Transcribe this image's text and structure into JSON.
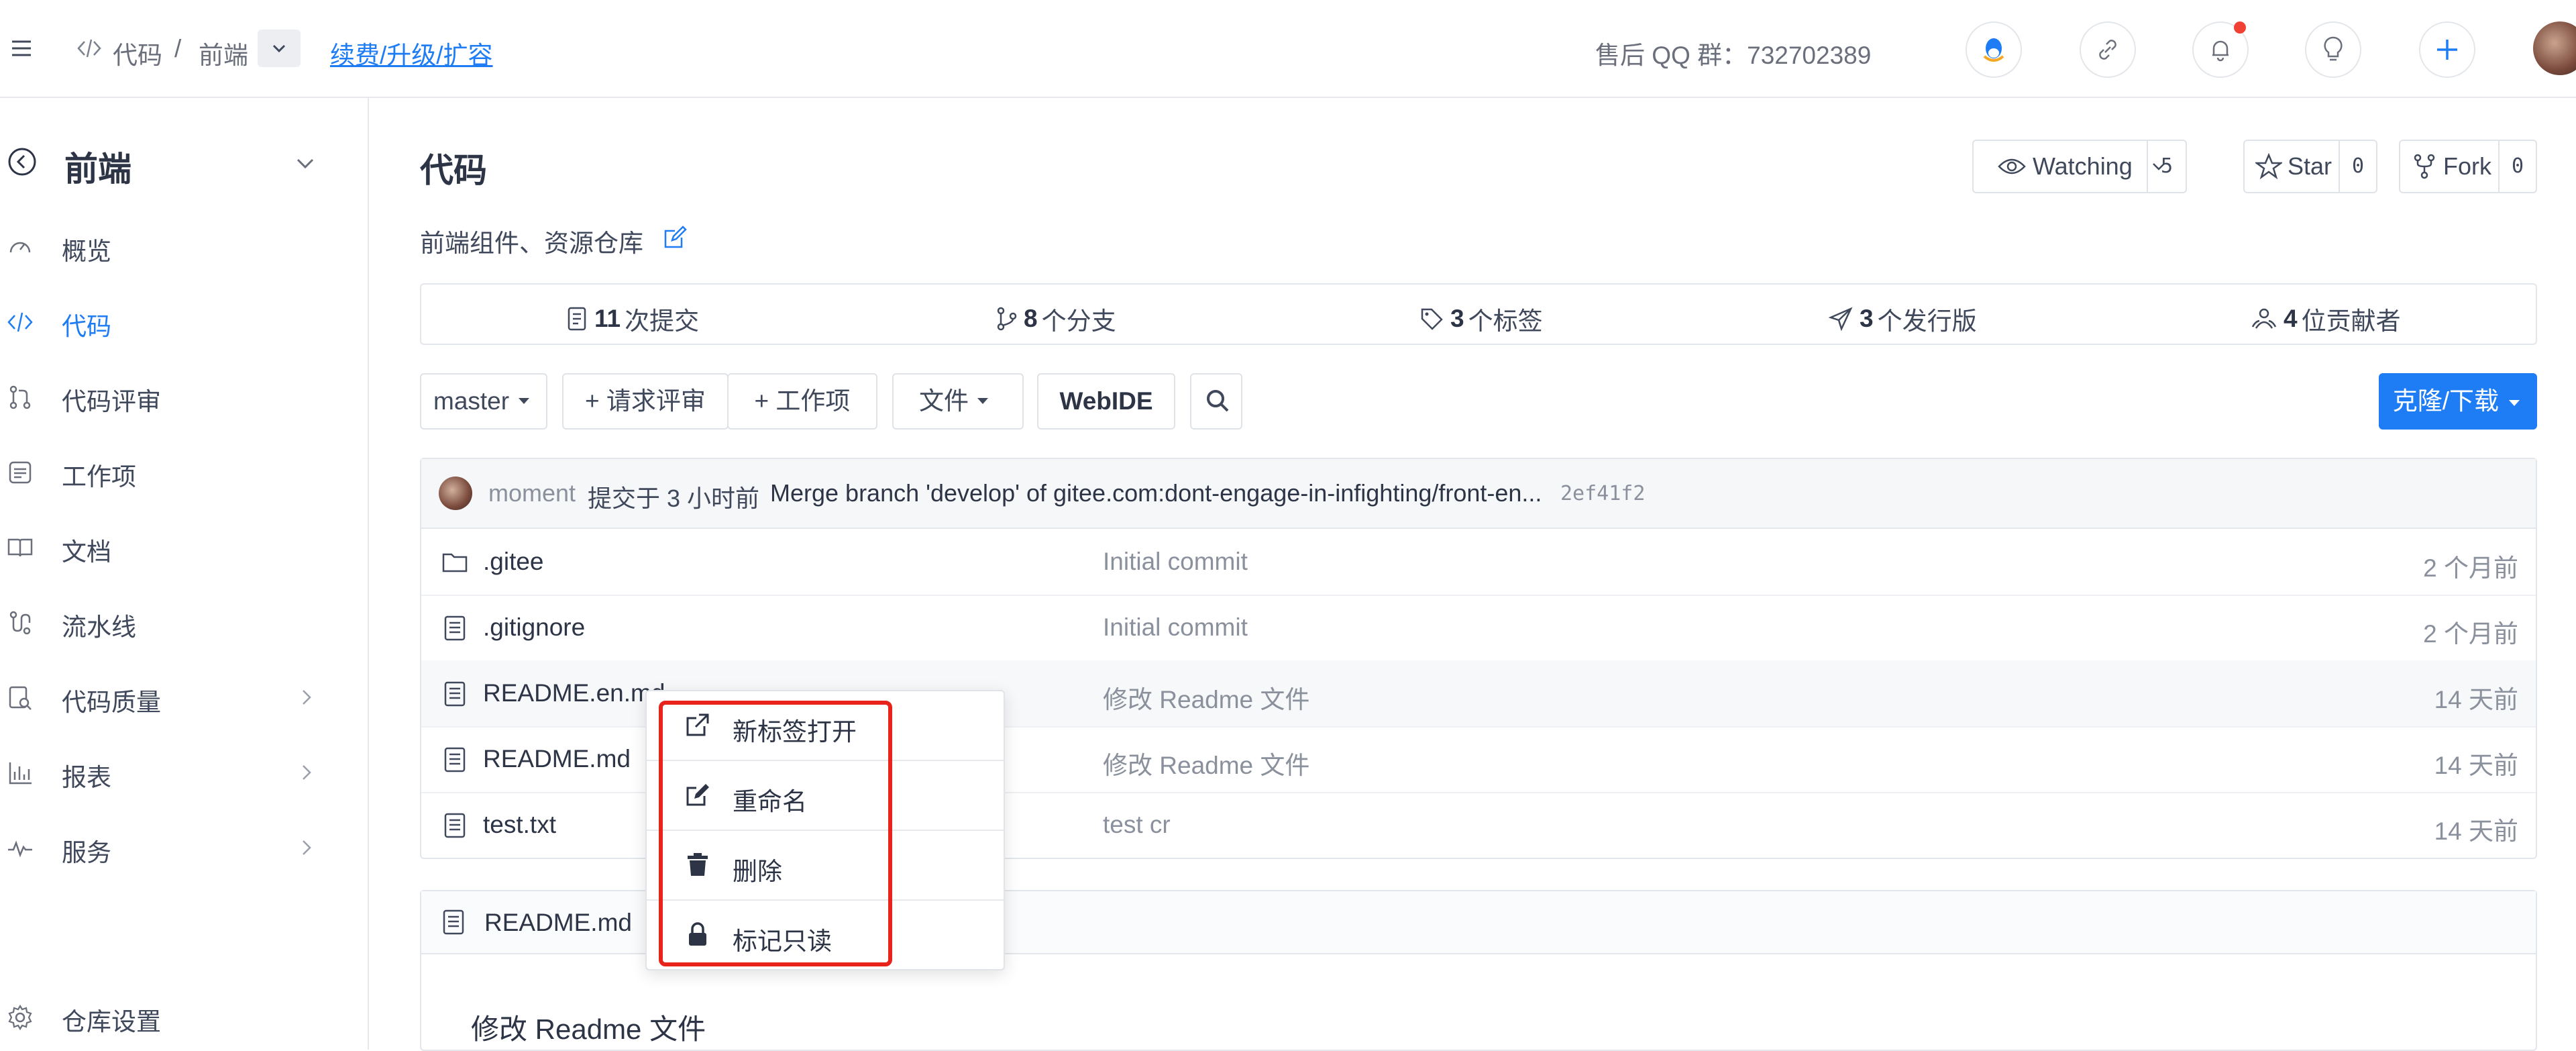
{
  "colors": {
    "accent": "#1e7cf4",
    "highlight": "#e8231b",
    "notification": "#f04134"
  },
  "topbar": {
    "crumb_code": "代码",
    "crumb_sep": "/",
    "crumb_repo": "前端",
    "renew_link": "续费/升级/扩容",
    "qq_group": "售后 QQ 群：732702389",
    "icons": [
      "menu-icon",
      "code-icon",
      "chevron-down-icon",
      "qq-icon",
      "link-icon",
      "bell-icon",
      "bulb-icon",
      "plus-icon"
    ]
  },
  "sidebar": {
    "repo_name": "前端",
    "items": [
      {
        "label": "概览",
        "icon": "dashboard-icon"
      },
      {
        "label": "代码",
        "icon": "code-icon"
      },
      {
        "label": "代码评审",
        "icon": "pull-request-icon"
      },
      {
        "label": "工作项",
        "icon": "task-icon"
      },
      {
        "label": "文档",
        "icon": "book-icon"
      },
      {
        "label": "流水线",
        "icon": "pipeline-icon"
      },
      {
        "label": "代码质量",
        "icon": "quality-icon"
      },
      {
        "label": "报表",
        "icon": "chart-icon"
      },
      {
        "label": "服务",
        "icon": "pulse-icon"
      }
    ],
    "settings": "仓库设置"
  },
  "repo": {
    "title": "代码",
    "description": "前端组件、资源仓库",
    "watching": {
      "label": "Watching",
      "count": "5"
    },
    "star": {
      "label": "Star",
      "count": "0"
    },
    "fork": {
      "label": "Fork",
      "count": "0"
    }
  },
  "stats": {
    "commits_n": "11",
    "commits_label": "次提交",
    "branches_n": "8",
    "branches_label": "个分支",
    "tags_n": "3",
    "tags_label": "个标签",
    "releases_n": "3",
    "releases_label": "个发行版",
    "contributors_n": "4",
    "contributors_label": "位贡献者"
  },
  "toolbar": {
    "branch": "master",
    "new_pr": "+ 请求评审",
    "new_issue": "+ 工作项",
    "file": "文件",
    "webide": "WebIDE",
    "clone": "克隆/下载"
  },
  "commit": {
    "author": "moment",
    "time": "提交于 3 小时前",
    "message": "Merge branch 'develop' of gitee.com:dont-engage-in-infighting/front-en...",
    "hash": "2ef41f2"
  },
  "files": [
    {
      "name": ".gitee",
      "type": "folder",
      "message": "Initial commit",
      "time": "2 个月前"
    },
    {
      "name": ".gitignore",
      "type": "file",
      "message": "Initial commit",
      "time": "2 个月前"
    },
    {
      "name": "README.en.md",
      "type": "file",
      "message": "修改 Readme 文件",
      "time": "14 天前"
    },
    {
      "name": "README.md",
      "type": "file",
      "message": "修改 Readme 文件",
      "time": "14 天前"
    },
    {
      "name": "test.txt",
      "type": "file",
      "message": "test cr",
      "time": "14 天前"
    }
  ],
  "readme": {
    "filename": "README.md",
    "heading": "修改 Readme 文件"
  },
  "context_menu": {
    "items": [
      {
        "label": "新标签打开",
        "icon": "external-link-icon"
      },
      {
        "label": "重命名",
        "icon": "edit-icon"
      },
      {
        "label": "删除",
        "icon": "trash-icon"
      },
      {
        "label": "标记只读",
        "icon": "lock-icon"
      }
    ]
  }
}
